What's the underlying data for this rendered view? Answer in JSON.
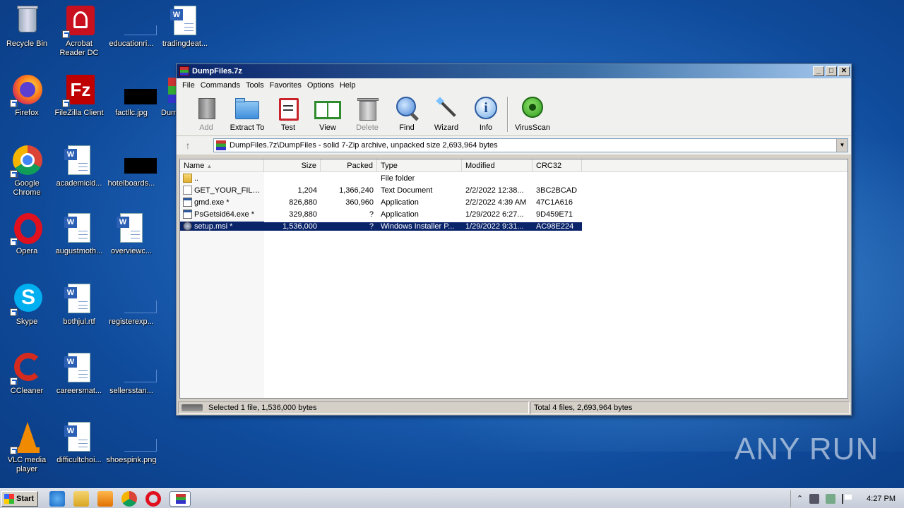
{
  "desktop": {
    "icons": [
      {
        "label": "Recycle Bin"
      },
      {
        "label": "Acrobat Reader DC"
      },
      {
        "label": "educationri..."
      },
      {
        "label": "tradingdeat..."
      },
      {
        "label": "Firefox"
      },
      {
        "label": "FileZilla Client"
      },
      {
        "label": "factllc.jpg"
      },
      {
        "label": "Dum"
      },
      {
        "label": "Google Chrome"
      },
      {
        "label": "academicid..."
      },
      {
        "label": "hotelboards..."
      },
      {
        "label": "Opera"
      },
      {
        "label": "augustmoth..."
      },
      {
        "label": "overviewc..."
      },
      {
        "label": "Skype"
      },
      {
        "label": "bothjul.rtf"
      },
      {
        "label": "registerexp..."
      },
      {
        "label": "CCleaner"
      },
      {
        "label": "careersmat..."
      },
      {
        "label": "sellersstan..."
      },
      {
        "label": "VLC media player"
      },
      {
        "label": "difficultchoi..."
      },
      {
        "label": "shoespink.png"
      }
    ]
  },
  "window": {
    "title": "DumpFiles.7z",
    "controls": {
      "minimize": "_",
      "maximize": "□",
      "close": "✕"
    },
    "menu": [
      "File",
      "Commands",
      "Tools",
      "Favorites",
      "Options",
      "Help"
    ],
    "toolbar": [
      {
        "label": "Add",
        "icon": "archive-add-icon",
        "disabled": true
      },
      {
        "label": "Extract To",
        "icon": "folder-extract-icon",
        "disabled": false
      },
      {
        "label": "Test",
        "icon": "clipboard-test-icon",
        "disabled": false
      },
      {
        "label": "View",
        "icon": "book-view-icon",
        "disabled": false
      },
      {
        "label": "Delete",
        "icon": "trash-icon",
        "disabled": true
      },
      {
        "label": "Find",
        "icon": "magnifier-icon",
        "disabled": false
      },
      {
        "label": "Wizard",
        "icon": "wand-icon",
        "disabled": false
      },
      {
        "label": "Info",
        "icon": "info-icon",
        "disabled": false
      },
      {
        "label": "VirusScan",
        "icon": "virus-scan-icon",
        "disabled": false
      }
    ],
    "up_arrow": "↑",
    "address": "DumpFiles.7z\\DumpFiles - solid 7-Zip archive, unpacked size 2,693,964 bytes",
    "columns": {
      "name": "Name",
      "size": "Size",
      "packed": "Packed",
      "type": "Type",
      "modified": "Modified",
      "crc": "CRC32"
    },
    "rows": [
      {
        "name": "..",
        "size": "",
        "packed": "",
        "type": "File folder",
        "modified": "",
        "crc": "",
        "icon": "folder",
        "selected": false
      },
      {
        "name": "GET_YOUR_FILE...",
        "size": "1,204",
        "packed": "1,366,240",
        "type": "Text Document",
        "modified": "2/2/2022 12:38...",
        "crc": "3BC2BCAD",
        "icon": "text",
        "selected": false
      },
      {
        "name": "gmd.exe *",
        "size": "826,880",
        "packed": "360,960",
        "type": "Application",
        "modified": "2/2/2022 4:39 AM",
        "crc": "47C1A616",
        "icon": "exe",
        "selected": false
      },
      {
        "name": "PsGetsid64.exe *",
        "size": "329,880",
        "packed": "?",
        "type": "Application",
        "modified": "1/29/2022 6:27...",
        "crc": "9D459E71",
        "icon": "exe",
        "selected": false
      },
      {
        "name": "setup.msi *",
        "size": "1,536,000",
        "packed": "?",
        "type": "Windows Installer P...",
        "modified": "1/29/2022 9:31...",
        "crc": "AC98E224",
        "icon": "msi",
        "selected": true
      }
    ],
    "status_left": "Selected 1 file, 1,536,000 bytes",
    "status_right": "Total 4 files, 2,693,964 bytes"
  },
  "taskbar": {
    "start_label": "Start",
    "clock": "4:27 PM"
  },
  "watermark": "ANY RUN"
}
